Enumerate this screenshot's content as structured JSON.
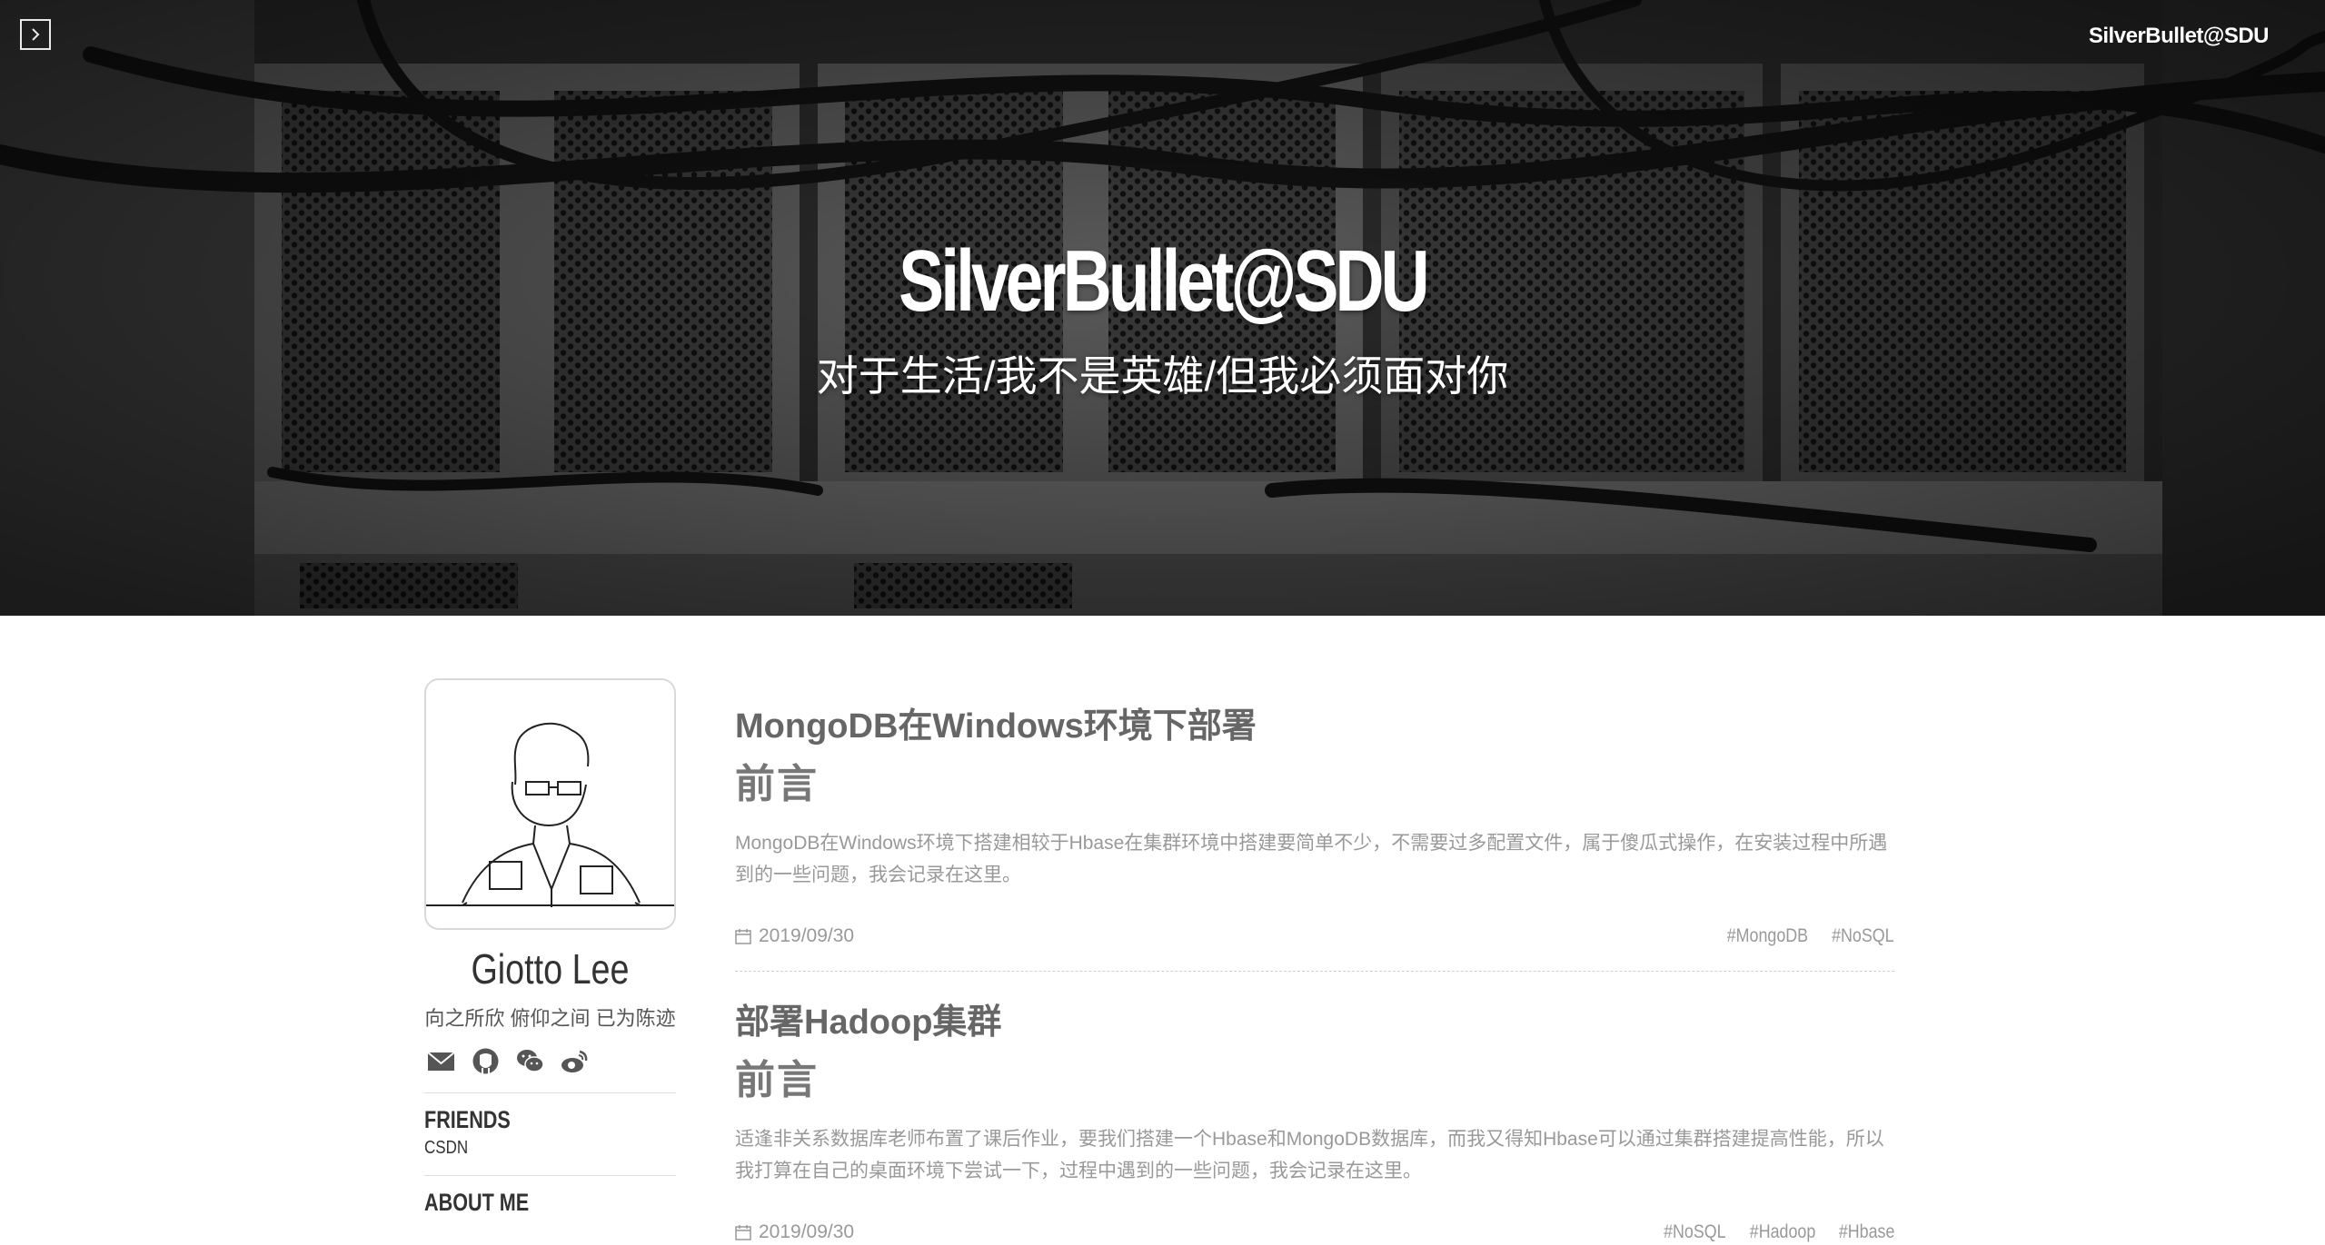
{
  "header": {
    "site_name": "SilverBullet@SDU",
    "title": "SilverBullet@SDU",
    "subtitle": "对于生活/我不是英雄/但我必须面对你"
  },
  "sidebar": {
    "author_name": "Giotto Lee",
    "motto": "向之所欣 俯仰之间 已为陈迹",
    "social_icons": [
      "mail-icon",
      "github-icon",
      "wechat-icon",
      "weibo-icon"
    ],
    "friends_heading": "FRIENDS",
    "friends": [
      "CSDN"
    ],
    "about_heading": "ABOUT ME"
  },
  "posts": [
    {
      "title": "MongoDB在Windows环境下部署",
      "heading": "前言",
      "excerpt": "MongoDB在Windows环境下搭建相较于Hbase在集群环境中搭建要简单不少，不需要过多配置文件，属于傻瓜式操作，在安装过程中所遇到的一些问题，我会记录在这里。",
      "date": "2019/09/30",
      "tags": [
        "#MongoDB",
        "#NoSQL"
      ]
    },
    {
      "title": "部署Hadoop集群",
      "heading": "前言",
      "excerpt": "适逢非关系数据库老师布置了课后作业，要我们搭建一个Hbase和MongoDB数据库，而我又得知Hbase可以通过集群搭建提高性能，所以我打算在自己的桌面环境下尝试一下，过程中遇到的一些问题，我会记录在这里。",
      "date": "2019/09/30",
      "tags": [
        "#NoSQL",
        "#Hadoop",
        "#Hbase"
      ]
    }
  ],
  "colors": {
    "hero_bg": "#1d1d1d",
    "text_muted": "#999999",
    "title_gray": "#666666"
  }
}
